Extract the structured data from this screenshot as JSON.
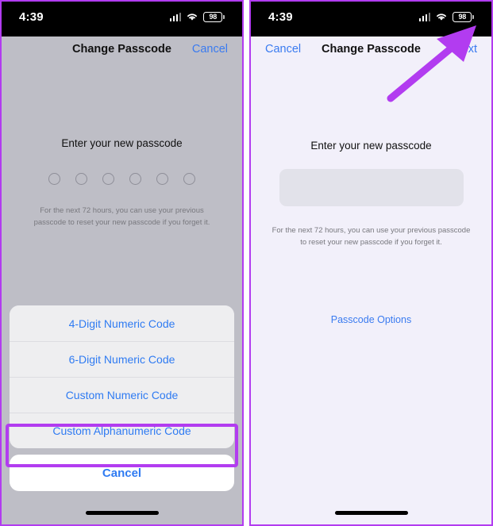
{
  "status_bar": {
    "time": "4:39",
    "battery_percent": "98",
    "signal_icon": "cellular-signal-icon",
    "wifi_icon": "wifi-icon",
    "battery_icon": "battery-icon"
  },
  "colors": {
    "accent_blue": "#3a7bf0",
    "annotation_purple": "#b23cf0",
    "left_backdrop": "#bebec6",
    "right_background": "#f2f0fa",
    "sheet_row": "#eeeef0",
    "input_fill": "#e2e2ea"
  },
  "left_panel": {
    "navbar": {
      "title": "Change Passcode",
      "right_button": "Cancel"
    },
    "prompt": "Enter your new passcode",
    "dots_count": 6,
    "hint": "For the next 72 hours, you can use your previous passcode to reset your new passcode if you forget it.",
    "action_sheet": {
      "options": [
        "4-Digit Numeric Code",
        "6-Digit Numeric Code",
        "Custom Numeric Code",
        "Custom Alphanumeric Code"
      ],
      "cancel": "Cancel",
      "highlighted_option_index": 3
    }
  },
  "right_panel": {
    "navbar": {
      "left_button": "Cancel",
      "title": "Change Passcode",
      "right_button": "Next"
    },
    "prompt": "Enter your new passcode",
    "passcode_field_value": "",
    "passcode_field_placeholder": "",
    "hint": "For the next 72 hours, you can use your previous passcode to reset your new passcode if you forget it.",
    "passcode_options_link": "Passcode Options",
    "annotation": {
      "type": "arrow",
      "points_to": "Next"
    }
  }
}
